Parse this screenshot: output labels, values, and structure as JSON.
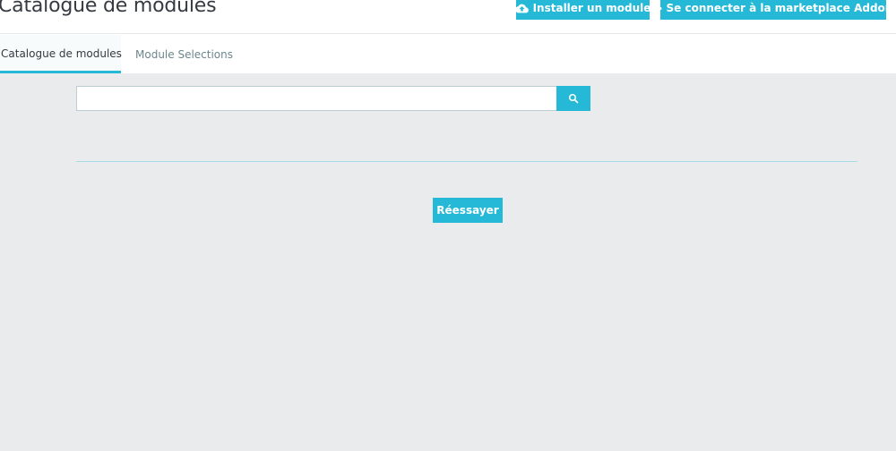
{
  "header": {
    "title": "Catalogue de modules",
    "install_label": "Installer un module",
    "install_icon": "cloud-upload-icon",
    "connect_label": "Se connecter à la marketplace Addons",
    "connect_icon": "key-icon"
  },
  "tabs": [
    {
      "label": "Catalogue de modules",
      "active": true
    },
    {
      "label": "Module Selections",
      "active": false
    }
  ],
  "search": {
    "value": "",
    "placeholder": "",
    "button_icon": "search-icon"
  },
  "retry": {
    "label": "Réessayer"
  },
  "colors": {
    "accent": "#25b9d7",
    "content_background": "#eaebec",
    "title_text": "#363a41",
    "inactive_tab_text": "#6c868e",
    "divider": "#a7dbe6"
  }
}
